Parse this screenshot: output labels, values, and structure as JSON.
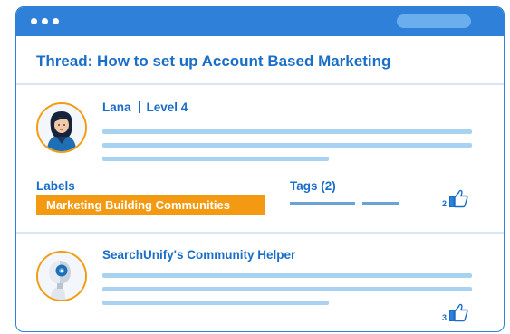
{
  "thread": {
    "title": "Thread: How to set up Account Based Marketing"
  },
  "post1": {
    "author": "Lana",
    "level": "Level 4",
    "labels_heading": "Labels",
    "label": "Marketing Building Communities",
    "tags_heading": "Tags (2)",
    "like_count": "2"
  },
  "post2": {
    "author": "SearchUnify's Community Helper",
    "like_count": "3"
  },
  "colors": {
    "accent_blue": "#2f80d8",
    "text_blue": "#1a6ec7",
    "label_orange": "#f39a12",
    "placeholder_line": "#a7d2f2"
  },
  "icons": {
    "like": "thumbs-up-icon",
    "window_dots": "window-control-dots"
  }
}
